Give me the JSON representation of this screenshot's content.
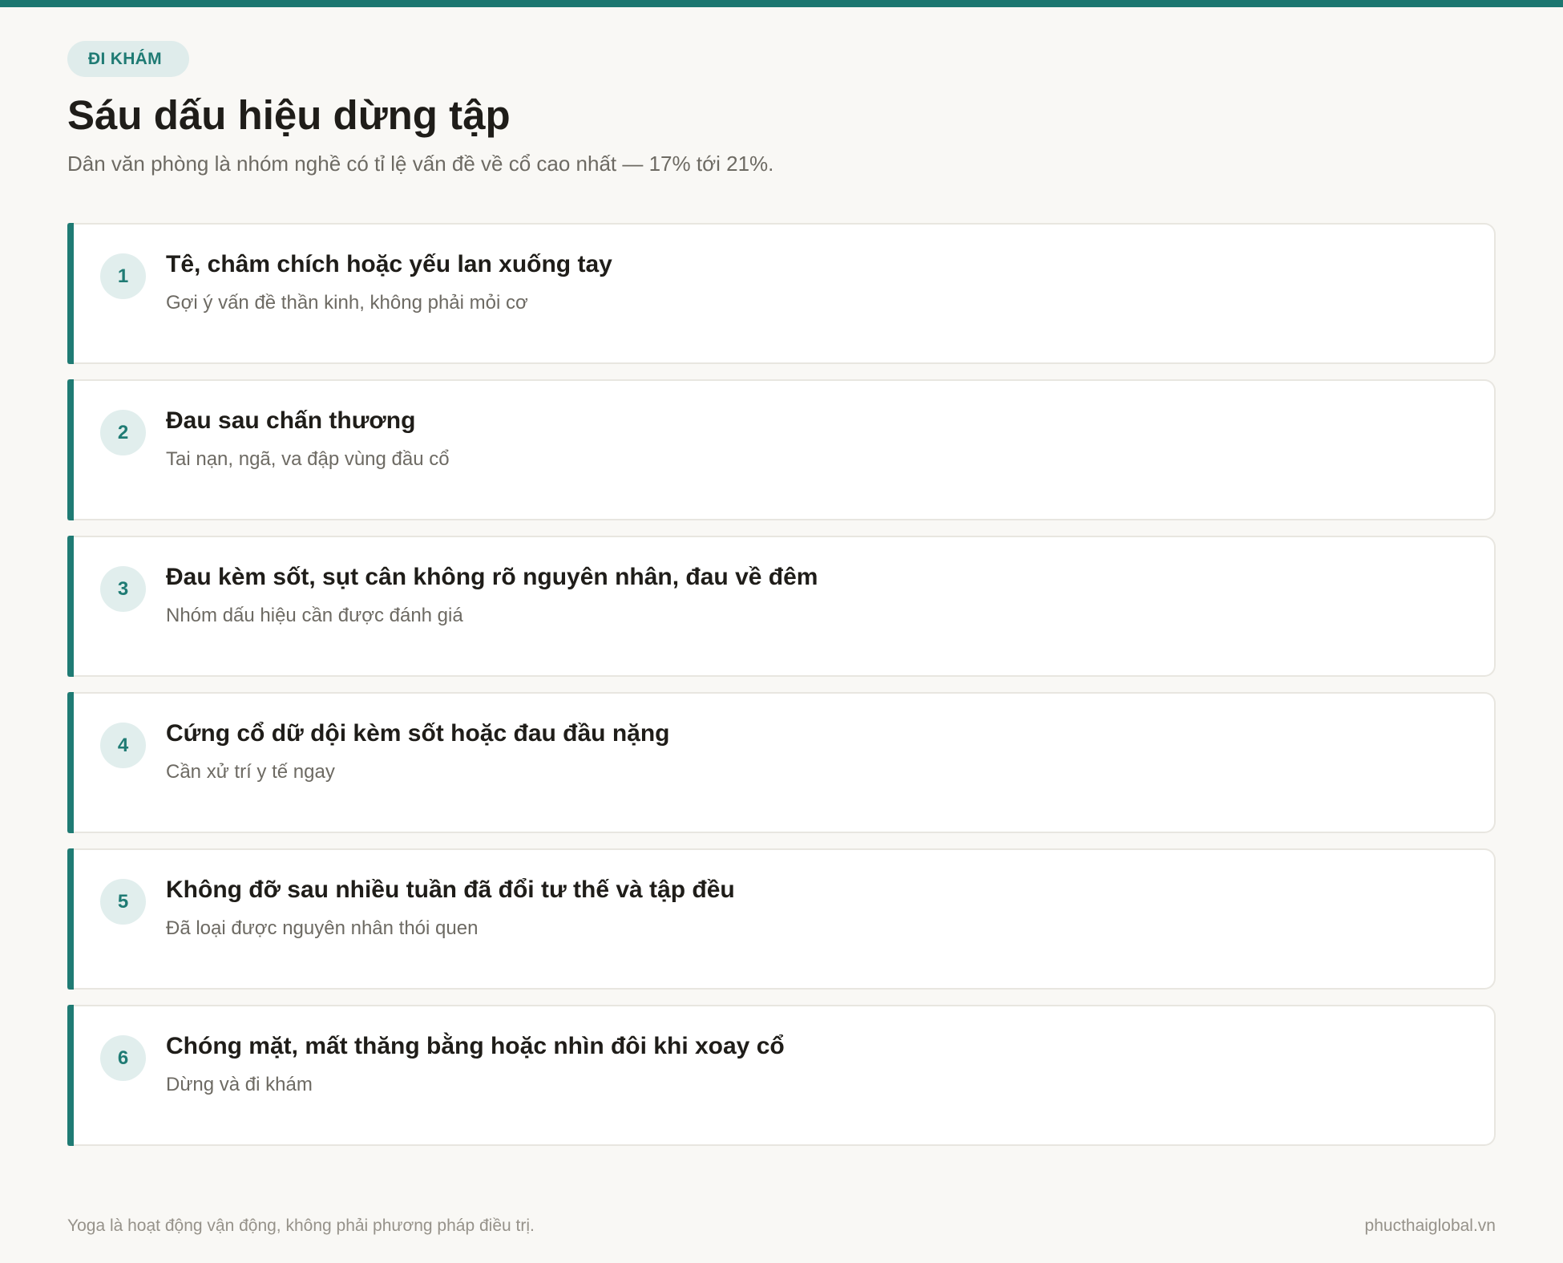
{
  "tag": "ĐI KHÁM",
  "title": "Sáu dấu hiệu dừng tập",
  "subtitle": "Dân văn phòng là nhóm nghề có tỉ lệ vấn đề về cổ cao nhất — 17% tới 21%.",
  "items": [
    {
      "number": "1",
      "title": "Tê, châm chích hoặc yếu lan xuống tay",
      "desc": "Gợi ý vấn đề thần kinh, không phải mỏi cơ"
    },
    {
      "number": "2",
      "title": "Đau sau chấn thương",
      "desc": "Tai nạn, ngã, va đập vùng đầu cổ"
    },
    {
      "number": "3",
      "title": "Đau kèm sốt, sụt cân không rõ nguyên nhân, đau về đêm",
      "desc": "Nhóm dấu hiệu cần được đánh giá"
    },
    {
      "number": "4",
      "title": "Cứng cổ dữ dội kèm sốt hoặc đau đầu nặng",
      "desc": "Cần xử trí y tế ngay"
    },
    {
      "number": "5",
      "title": "Không đỡ sau nhiều tuần đã đổi tư thế và tập đều",
      "desc": "Đã loại được nguyên nhân thói quen"
    },
    {
      "number": "6",
      "title": "Chóng mặt, mất thăng bằng hoặc nhìn đôi khi xoay cổ",
      "desc": "Dừng và đi khám"
    }
  ],
  "footer": {
    "note": "Yoga là hoạt động vận động, không phải phương pháp điều trị.",
    "site": "phucthaiglobal.vn"
  },
  "colors": {
    "accent": "#1f7b74",
    "top_bar": "#1c7770",
    "badge_bg": "#e1eeed",
    "background": "#f9f8f5"
  }
}
